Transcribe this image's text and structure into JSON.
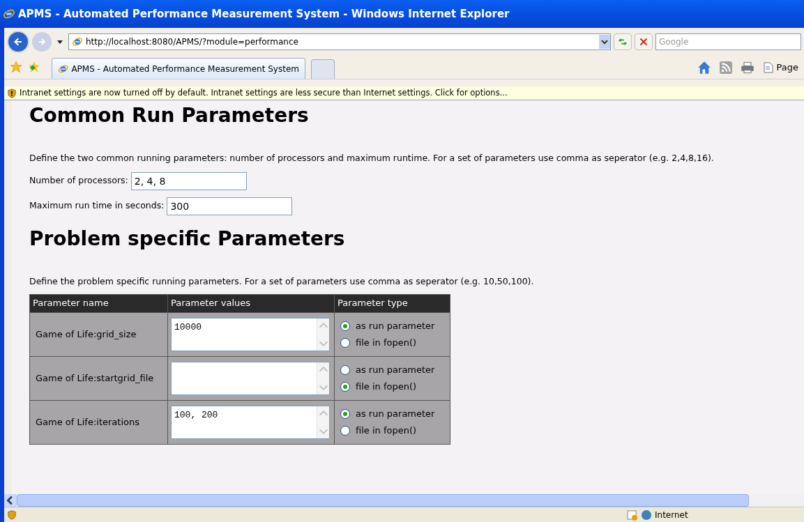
{
  "window": {
    "title": "APMS - Automated Performance Measurement System - Windows Internet Explorer"
  },
  "address_bar": {
    "url": "http://localhost:8080/APMS/?module=performance"
  },
  "search": {
    "placeholder": "Google"
  },
  "tabs": [
    {
      "label": "APMS - Automated Performance Measurement System",
      "selected": true
    }
  ],
  "toolbar": {
    "page_menu": "Page"
  },
  "info_bar": "Intranet settings are now turned off by default. Intranet settings are less secure than Internet settings. Click for options...",
  "common": {
    "heading": "Common Run Parameters",
    "description": "Define the two common running parameters: number of processors and maximum runtime. For a set of parameters use comma as seperator (e.g. 2,4,8,16).",
    "fields": [
      {
        "label": "Number of processors:",
        "value": "2, 4, 8"
      },
      {
        "label": "Maximum run time in seconds:",
        "value": "300"
      }
    ]
  },
  "problem": {
    "heading": "Problem specific Parameters",
    "description": "Define the problem specific running parameters. For a set of parameters use comma as seperator (e.g. 10,50,100).",
    "columns": [
      "Parameter name",
      "Parameter values",
      "Parameter type"
    ],
    "rows": [
      {
        "name": "Game of Life:grid_size",
        "value": "10000",
        "options": [
          {
            "label": "as run parameter",
            "selected": true
          },
          {
            "label": "file in fopen()",
            "selected": false
          }
        ]
      },
      {
        "name": "Game of Life:startgrid_file",
        "value": "",
        "options": [
          {
            "label": "as run parameter",
            "selected": false
          },
          {
            "label": "file in fopen()",
            "selected": true
          }
        ]
      },
      {
        "name": "Game of Life:iterations",
        "value": "100, 200",
        "options": [
          {
            "label": "as run parameter",
            "selected": true
          },
          {
            "label": "file in fopen()",
            "selected": false
          }
        ]
      }
    ]
  },
  "status_bar": {
    "zone": "Internet"
  }
}
